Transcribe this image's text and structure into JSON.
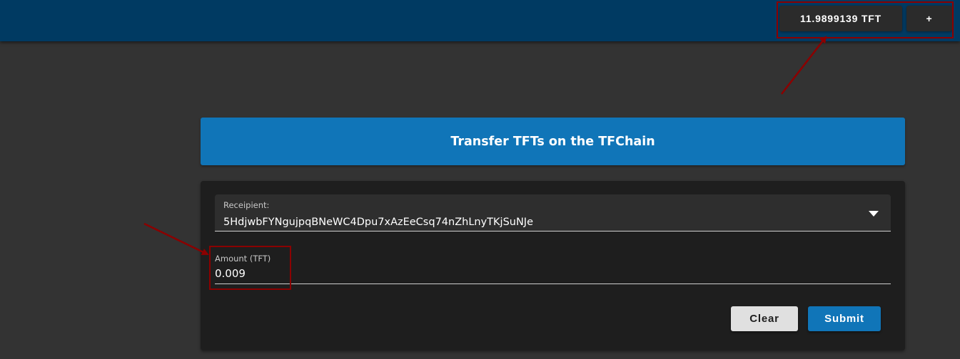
{
  "header": {
    "balance_label": "11.9899139 TFT",
    "add_label": "+"
  },
  "transfer": {
    "title": "Transfer TFTs on the TFChain",
    "recipient": {
      "label": "Receipient:",
      "value": "5HdjwbFYNgujpqBNeWC4Dpu7xAzEeCsq74nZhLnyTKjSuNJe"
    },
    "amount": {
      "label": "Amount (TFT)",
      "value": "0.009"
    },
    "clear_label": "Clear",
    "submit_label": "Submit"
  },
  "colors": {
    "header_bg": "#003a62",
    "primary": "#1075b8",
    "annotation": "#8b0000"
  }
}
